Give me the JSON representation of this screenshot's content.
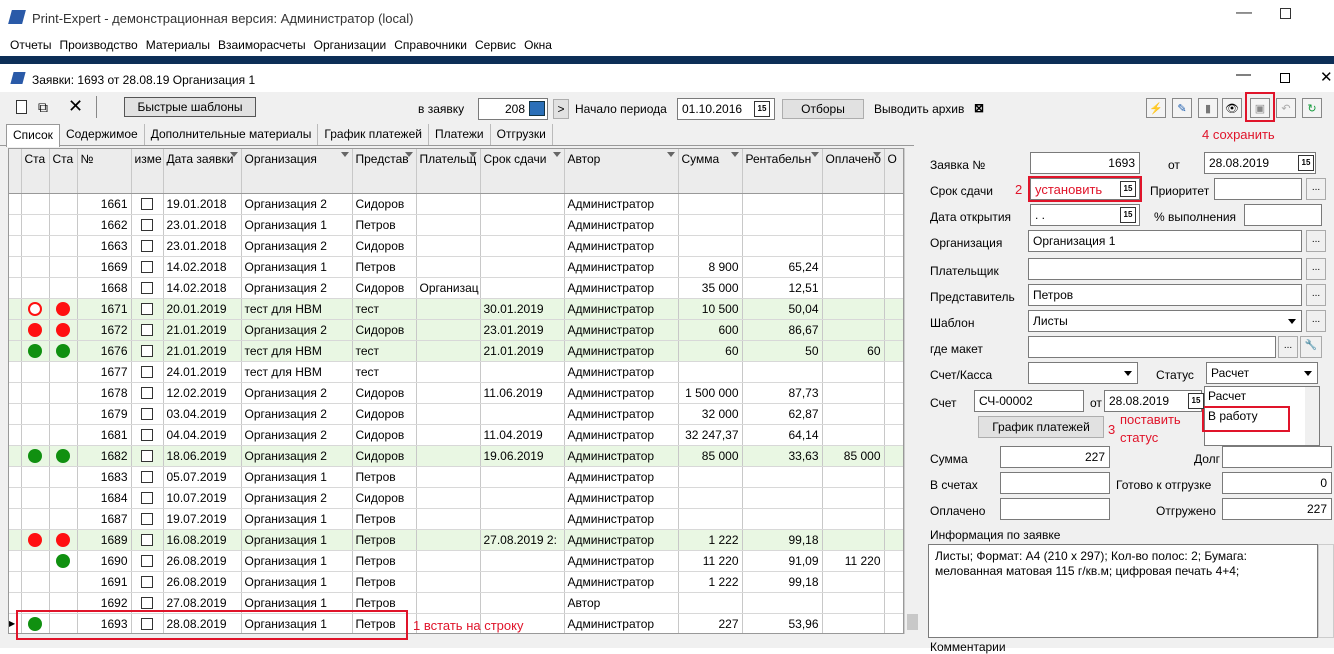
{
  "app": {
    "title": "Print-Expert - демонстрационная версия: Администратор (local)",
    "menu": [
      "Отчеты",
      "Производство",
      "Материалы",
      "Взаиморасчеты",
      "Организации",
      "Справочники",
      "Сервис",
      "Окна"
    ]
  },
  "window": {
    "title": "Заявки: 1693 от 28.08.19  Организация 1"
  },
  "toolbar": {
    "quick_templates": "Быстрые шаблоны",
    "to_request_label": "в заявку",
    "request_no": "208",
    "period_label": "Начало периода",
    "period_value": "01.10.2016",
    "filters": "Отборы",
    "archive_label": "Выводить архив",
    "annotation_4": "4  сохранить"
  },
  "tabs": [
    "Список",
    "Содержимое",
    "Дополнительные материалы",
    "График платежей",
    "Платежи",
    "Отгрузки"
  ],
  "grid": {
    "headers": [
      "Ста отгр",
      "Ста опл",
      "№",
      "изме без",
      "Дата заявки",
      "Организация",
      "Представ",
      "Плательщ",
      "Срок сдачи",
      "Автор",
      "Сумма",
      "Рентабельн",
      "Оплачено",
      "О"
    ],
    "rows": [
      {
        "s1": "",
        "s2": "",
        "no": "1661",
        "date": "19.01.2018",
        "org": "Организация 2",
        "rep": "Сидоров",
        "payer": "",
        "due": "",
        "author": "Администратор",
        "sum": "",
        "rent": "",
        "paid": "",
        "green": false
      },
      {
        "s1": "",
        "s2": "",
        "no": "1662",
        "date": "23.01.2018",
        "org": "Организация 1",
        "rep": "Петров",
        "payer": "",
        "due": "",
        "author": "Администратор",
        "sum": "",
        "rent": "",
        "paid": "",
        "green": false
      },
      {
        "s1": "",
        "s2": "",
        "no": "1663",
        "date": "23.01.2018",
        "org": "Организация 2",
        "rep": "Сидоров",
        "payer": "",
        "due": "",
        "author": "Администратор",
        "sum": "",
        "rent": "",
        "paid": "",
        "green": false
      },
      {
        "s1": "",
        "s2": "",
        "no": "1669",
        "date": "14.02.2018",
        "org": "Организация 1",
        "rep": "Петров",
        "payer": "",
        "due": "",
        "author": "Администратор",
        "sum": "8 900",
        "rent": "65,24",
        "paid": "",
        "green": false
      },
      {
        "s1": "",
        "s2": "",
        "no": "1668",
        "date": "14.02.2018",
        "org": "Организация 2",
        "rep": "Сидоров",
        "payer": "Организац",
        "due": "",
        "author": "Администратор",
        "sum": "35 000",
        "rent": "12,51",
        "paid": "",
        "green": false
      },
      {
        "s1": "hollow",
        "s2": "red",
        "no": "1671",
        "date": "20.01.2019",
        "org": "тест для НВМ",
        "rep": "тест",
        "payer": "",
        "due": "30.01.2019",
        "author": "Администратор",
        "sum": "10 500",
        "rent": "50,04",
        "paid": "",
        "green": true
      },
      {
        "s1": "red",
        "s2": "red",
        "no": "1672",
        "date": "21.01.2019",
        "org": "Организация 2",
        "rep": "Сидоров",
        "payer": "",
        "due": "23.01.2019",
        "author": "Администратор",
        "sum": "600",
        "rent": "86,67",
        "paid": "",
        "green": true
      },
      {
        "s1": "green",
        "s2": "green",
        "no": "1676",
        "date": "21.01.2019",
        "org": "тест для НВМ",
        "rep": "тест",
        "payer": "",
        "due": "21.01.2019",
        "author": "Администратор",
        "sum": "60",
        "rent": "50",
        "paid": "60",
        "green": true
      },
      {
        "s1": "",
        "s2": "",
        "no": "1677",
        "date": "24.01.2019",
        "org": "тест для НВМ",
        "rep": "тест",
        "payer": "",
        "due": "",
        "author": "Администратор",
        "sum": "",
        "rent": "",
        "paid": "",
        "green": false
      },
      {
        "s1": "",
        "s2": "",
        "no": "1678",
        "date": "12.02.2019",
        "org": "Организация 2",
        "rep": "Сидоров",
        "payer": "",
        "due": "11.06.2019",
        "author": "Администратор",
        "sum": "1 500 000",
        "rent": "87,73",
        "paid": "",
        "green": false
      },
      {
        "s1": "",
        "s2": "",
        "no": "1679",
        "date": "03.04.2019",
        "org": "Организация 2",
        "rep": "Сидоров",
        "payer": "",
        "due": "",
        "author": "Администратор",
        "sum": "32 000",
        "rent": "62,87",
        "paid": "",
        "green": false
      },
      {
        "s1": "",
        "s2": "",
        "no": "1681",
        "date": "04.04.2019",
        "org": "Организация 2",
        "rep": "Сидоров",
        "payer": "",
        "due": "11.04.2019",
        "author": "Администратор",
        "sum": "32 247,37",
        "rent": "64,14",
        "paid": "",
        "green": false
      },
      {
        "s1": "green",
        "s2": "green",
        "no": "1682",
        "date": "18.06.2019",
        "org": "Организация 2",
        "rep": "Сидоров",
        "payer": "",
        "due": "19.06.2019",
        "author": "Администратор",
        "sum": "85 000",
        "rent": "33,63",
        "paid": "85 000",
        "green": true
      },
      {
        "s1": "",
        "s2": "",
        "no": "1683",
        "date": "05.07.2019",
        "org": "Организация 1",
        "rep": "Петров",
        "payer": "",
        "due": "",
        "author": "Администратор",
        "sum": "",
        "rent": "",
        "paid": "",
        "green": false
      },
      {
        "s1": "",
        "s2": "",
        "no": "1684",
        "date": "10.07.2019",
        "org": "Организация 2",
        "rep": "Сидоров",
        "payer": "",
        "due": "",
        "author": "Администратор",
        "sum": "",
        "rent": "",
        "paid": "",
        "green": false
      },
      {
        "s1": "",
        "s2": "",
        "no": "1687",
        "date": "19.07.2019",
        "org": "Организация 1",
        "rep": "Петров",
        "payer": "",
        "due": "",
        "author": "Администратор",
        "sum": "",
        "rent": "",
        "paid": "",
        "green": false
      },
      {
        "s1": "red",
        "s2": "red",
        "no": "1689",
        "date": "16.08.2019",
        "org": "Организация 1",
        "rep": "Петров",
        "payer": "",
        "due": "27.08.2019 2:",
        "author": "Администратор",
        "sum": "1 222",
        "rent": "99,18",
        "paid": "",
        "green": true
      },
      {
        "s1": "",
        "s2": "green",
        "no": "1690",
        "date": "26.08.2019",
        "org": "Организация 1",
        "rep": "Петров",
        "payer": "",
        "due": "",
        "author": "Администратор",
        "sum": "11 220",
        "rent": "91,09",
        "paid": "11 220",
        "green": false
      },
      {
        "s1": "",
        "s2": "",
        "no": "1691",
        "date": "26.08.2019",
        "org": "Организация 1",
        "rep": "Петров",
        "payer": "",
        "due": "",
        "author": "Администратор",
        "sum": "1 222",
        "rent": "99,18",
        "paid": "",
        "green": false
      },
      {
        "s1": "",
        "s2": "",
        "no": "1692",
        "date": "27.08.2019",
        "org": "Организация 1",
        "rep": "Петров",
        "payer": "",
        "due": "",
        "author": "Автор",
        "sum": "",
        "rent": "",
        "paid": "",
        "green": false
      },
      {
        "s1": "green",
        "s2": "",
        "no": "1693",
        "date": "28.08.2019",
        "org": "Организация 1",
        "rep": "Петров",
        "payer": "",
        "due": "",
        "author": "Администратор",
        "sum": "227",
        "rent": "53,96",
        "paid": "",
        "green": false,
        "selected": true
      }
    ],
    "annotation_1": "1  встать на строку"
  },
  "form": {
    "request_no_label": "Заявка №",
    "request_no": "1693",
    "from_label": "от",
    "from_date": "28.08.2019",
    "due_label": "Срок сдачи",
    "annotation_2_num": "2",
    "due_value": "установить",
    "priority_label": "Приоритет",
    "open_date_label": "Дата открытия",
    "open_date": ".  .",
    "percent_label": "% выполнения",
    "org_label": "Организация",
    "org_value": "Организация 1",
    "payer_label": "Плательщик",
    "rep_label": "Представитель",
    "rep_value": "Петров",
    "template_label": "Шаблон",
    "template_value": "Листы",
    "layout_label": "где макет",
    "account_label": "Счет/Касса",
    "status_label": "Статус",
    "status_value": "Расчет",
    "status_options": [
      "Расчет",
      "В работу"
    ],
    "invoice_label": "Счет",
    "invoice_value": "СЧ-00002",
    "invoice_from_label": "от",
    "invoice_date": "28.08.2019",
    "pay_schedule_btn": "График платежей",
    "annotation_3_num": "3",
    "annotation_3_text_a": "поставить",
    "annotation_3_text_b": "статус",
    "sum_label": "Сумма",
    "sum_value": "227",
    "debt_label": "Долг",
    "in_accounts_label": "В счетах",
    "ready_ship_label": "Готово к отгрузке",
    "ready_ship_value": "0",
    "paid_label": "Оплачено",
    "shipped_label": "Отгружено",
    "shipped_value": "227",
    "info_label": "Информация по заявке",
    "info_text": "Листы; Формат: A4 (210 x 297); Кол-во полос: 2;  Бумага: мелованная матовая 115 г/кв.м; цифровая печать 4+4;",
    "comments_label": "Комментарии"
  },
  "colors": {
    "accent_red": "#e0142a",
    "selection_blue": "#1f1fbf",
    "row_green": "#e9f7e3",
    "band": "#0d2e57"
  }
}
